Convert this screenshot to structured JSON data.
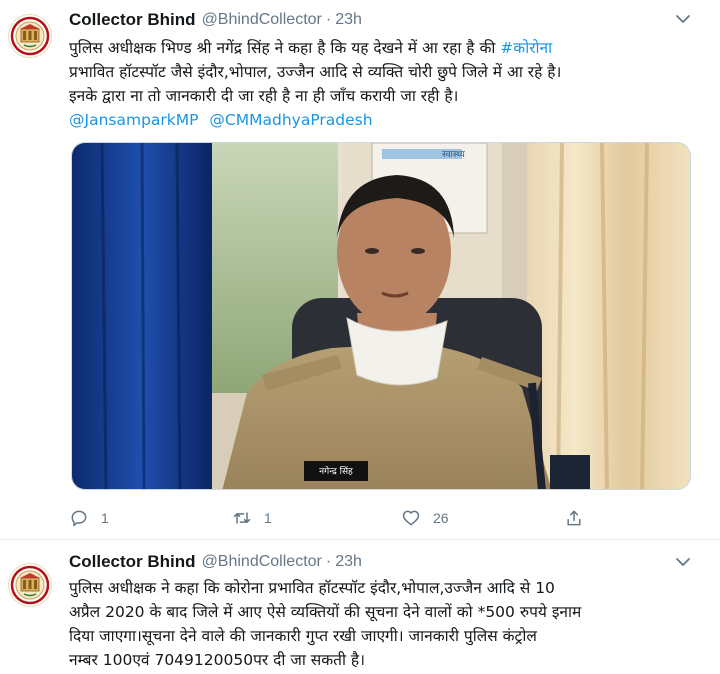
{
  "tweets": [
    {
      "name": "Collector Bhind",
      "handle": "@BhindCollector",
      "separator": "·",
      "time": "23h",
      "lines": [
        "पुलिस अधीक्षक भिण्ड श्री नगेंद्र सिंह ने कहा है कि यह देखने में आ रहा है की ",
        "प्रभावित हॉटस्पॉट जैसे इंदौर,भोपाल, उज्जैन आदि से व्यक्ति चोरी छुपे जिले में आ रहे है।",
        "इनके द्वारा ना तो जानकारी दी जा रही है ना ही जाँच करायी जा रही है।"
      ],
      "hashtag": "#कोरोना",
      "mentions": [
        "@JansamparkMP",
        "@CMMadhyaPradesh"
      ],
      "media_badge": "नगेन्द्र सिंह",
      "media_alt_text": "स्वास्थ्य",
      "replies": "1",
      "retweets": "1",
      "likes": "26"
    },
    {
      "name": "Collector Bhind",
      "handle": "@BhindCollector",
      "separator": "·",
      "time": "23h",
      "lines": [
        "पुलिस अधीक्षक ने कहा कि कोरोना प्रभावित हॉटस्पॉट इंदौर,भोपाल,उज्जैन आदि से 10",
        "अप्रैल 2020 के बाद जिले में आए ऐसे व्यक्तियों की सूचना देने वालों को *500 रुपये इनाम",
        "दिया जाएगा।सूचना देने वाले की जानकारी गुप्त रखी जाएगी। जानकारी पुलिस कंट्रोल",
        "नम्बर 100एवं 7049120050पर दी जा सकती है।"
      ]
    }
  ],
  "icons": {
    "avatar": "district-emblem-icon",
    "caret": "chevron-down-icon",
    "reply": "reply-icon",
    "retweet": "retweet-icon",
    "like": "heart-icon",
    "share": "share-icon"
  },
  "colors": {
    "link": "#1b95e0",
    "muted": "#657786",
    "text": "#14171a"
  }
}
